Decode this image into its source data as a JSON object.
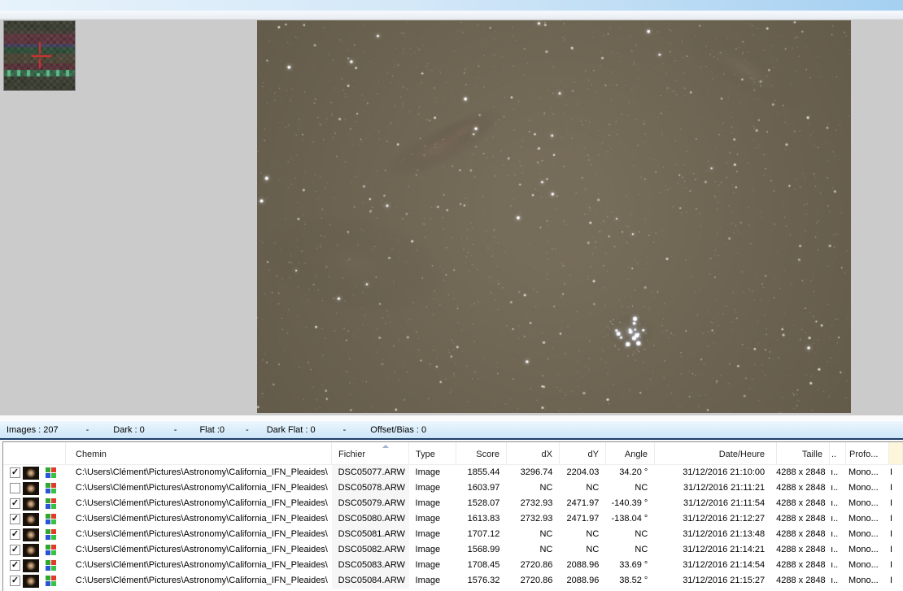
{
  "status_bar": {
    "images": "Images : 207",
    "sep1": "-",
    "dark": "Dark : 0",
    "sep2": "-",
    "flat": "Flat :0",
    "sep3": "-",
    "dark_flat": "Dark Flat : 0",
    "sep4": "-",
    "offset_bias": "Offset/Bias : 0"
  },
  "table": {
    "columns": {
      "chemin": "Chemin",
      "fichier": "Fichier",
      "type": "Type",
      "score": "Score",
      "dx": "dX",
      "dy": "dY",
      "angle": "Angle",
      "date_heure": "Date/Heure",
      "taille": "Taille",
      "narrow": "..",
      "profondeur": "Profo...",
      "partial": ""
    },
    "sort_column": "fichier",
    "sort_direction": "asc",
    "rows": [
      {
        "checked": true,
        "chemin": "C:\\Users\\Clément\\Pictures\\Astronomy\\California_IFN_Pleaides\\",
        "fichier": "DSC05077.ARW",
        "type": "Image",
        "score": "1855.44",
        "dx": "3296.74",
        "dy": "2204.03",
        "angle": "34.20 °",
        "date_heure": "31/12/2016 21:10:00",
        "taille": "4288 x 2848",
        "narrow": "ı..",
        "profondeur": "Mono...",
        "partial": "I"
      },
      {
        "checked": false,
        "chemin": "C:\\Users\\Clément\\Pictures\\Astronomy\\California_IFN_Pleaides\\",
        "fichier": "DSC05078.ARW",
        "type": "Image",
        "score": "1603.97",
        "dx": "NC",
        "dy": "NC",
        "angle": "NC",
        "date_heure": "31/12/2016 21:11:21",
        "taille": "4288 x 2848",
        "narrow": "ı..",
        "profondeur": "Mono...",
        "partial": "I"
      },
      {
        "checked": true,
        "chemin": "C:\\Users\\Clément\\Pictures\\Astronomy\\California_IFN_Pleaides\\",
        "fichier": "DSC05079.ARW",
        "type": "Image",
        "score": "1528.07",
        "dx": "2732.93",
        "dy": "2471.97",
        "angle": "-140.39 °",
        "date_heure": "31/12/2016 21:11:54",
        "taille": "4288 x 2848",
        "narrow": "ı..",
        "profondeur": "Mono...",
        "partial": "I"
      },
      {
        "checked": true,
        "chemin": "C:\\Users\\Clément\\Pictures\\Astronomy\\California_IFN_Pleaides\\",
        "fichier": "DSC05080.ARW",
        "type": "Image",
        "score": "1613.83",
        "dx": "2732.93",
        "dy": "2471.97",
        "angle": "-138.04 °",
        "date_heure": "31/12/2016 21:12:27",
        "taille": "4288 x 2848",
        "narrow": "ı..",
        "profondeur": "Mono...",
        "partial": "I"
      },
      {
        "checked": true,
        "chemin": "C:\\Users\\Clément\\Pictures\\Astronomy\\California_IFN_Pleaides\\",
        "fichier": "DSC05081.ARW",
        "type": "Image",
        "score": "1707.12",
        "dx": "NC",
        "dy": "NC",
        "angle": "NC",
        "date_heure": "31/12/2016 21:13:48",
        "taille": "4288 x 2848",
        "narrow": "ı..",
        "profondeur": "Mono...",
        "partial": "I"
      },
      {
        "checked": true,
        "chemin": "C:\\Users\\Clément\\Pictures\\Astronomy\\California_IFN_Pleaides\\",
        "fichier": "DSC05082.ARW",
        "type": "Image",
        "score": "1568.99",
        "dx": "NC",
        "dy": "NC",
        "angle": "NC",
        "date_heure": "31/12/2016 21:14:21",
        "taille": "4288 x 2848",
        "narrow": "ı..",
        "profondeur": "Mono...",
        "partial": "I"
      },
      {
        "checked": true,
        "chemin": "C:\\Users\\Clément\\Pictures\\Astronomy\\California_IFN_Pleaides\\",
        "fichier": "DSC05083.ARW",
        "type": "Image",
        "score": "1708.45",
        "dx": "2720.86",
        "dy": "2088.96",
        "angle": "33.69 °",
        "date_heure": "31/12/2016 21:14:54",
        "taille": "4288 x 2848",
        "narrow": "ı..",
        "profondeur": "Mono...",
        "partial": "I"
      },
      {
        "checked": true,
        "chemin": "C:\\Users\\Clément\\Pictures\\Astronomy\\California_IFN_Pleaides\\",
        "fichier": "DSC05084.ARW",
        "type": "Image",
        "score": "1576.32",
        "dx": "2720.86",
        "dy": "2088.96",
        "angle": "38.52 °",
        "date_heure": "31/12/2016 21:15:27",
        "taille": "4288 x 2848",
        "narrow": "ı..",
        "profondeur": "Mono...",
        "partial": "I"
      }
    ]
  },
  "icons": {
    "row_check": "✓",
    "cfa_icon": "bayer-rgb-pattern",
    "sort_asc_icon": "triangle-up",
    "zoom_crosshair": "red-cross"
  },
  "colors": {
    "titlebar_left": "#e7f2fb",
    "titlebar_right": "#a5d0f1",
    "status_top": "#ecf7fe",
    "status_bottom": "#cde6f8",
    "status_border": "#20406a",
    "workarea": "#cbcbcb",
    "sky_base": "#6f6654",
    "sorted_column_bg": "#f6f6f6"
  }
}
